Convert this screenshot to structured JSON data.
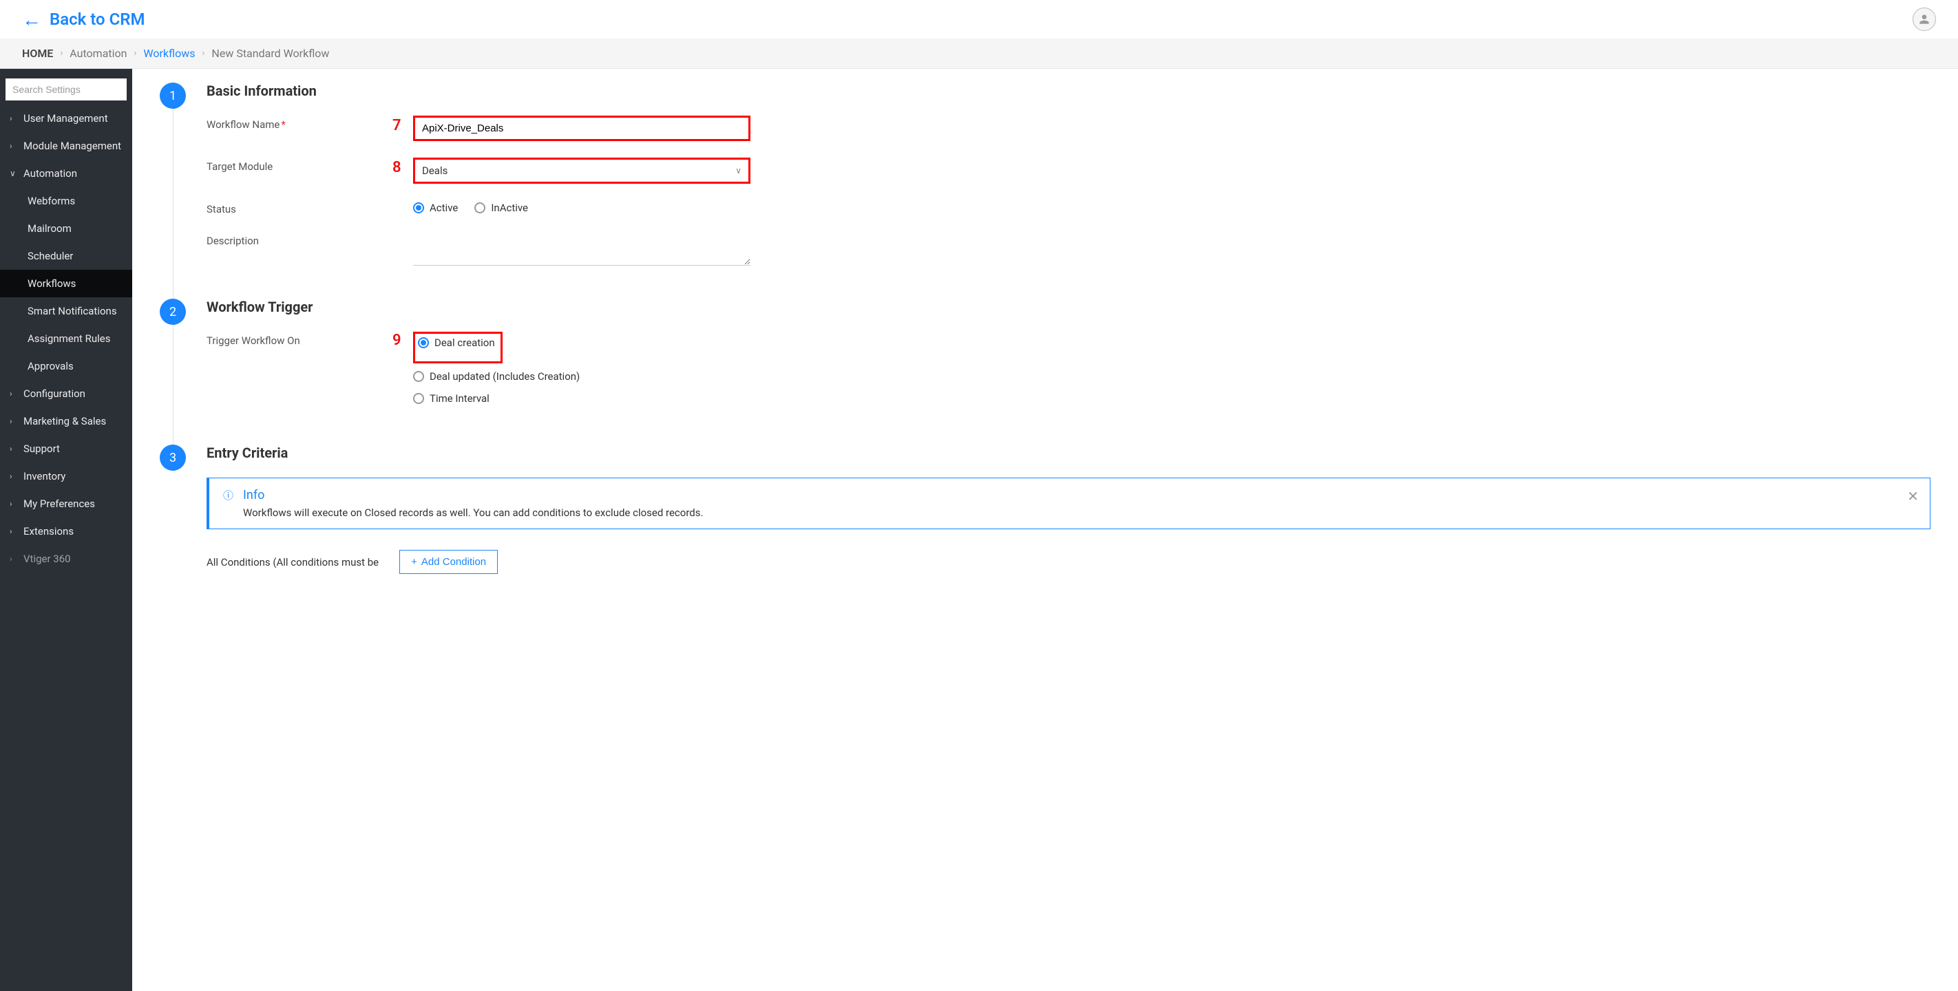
{
  "topbar": {
    "back_label": "Back to CRM"
  },
  "breadcrumb": {
    "home": "HOME",
    "automation": "Automation",
    "workflows": "Workflows",
    "current": "New Standard Workflow"
  },
  "sidebar": {
    "search_placeholder": "Search Settings",
    "items": [
      {
        "label": "User Management",
        "expanded": false
      },
      {
        "label": "Module Management",
        "expanded": false
      },
      {
        "label": "Automation",
        "expanded": true,
        "children": [
          {
            "label": "Webforms"
          },
          {
            "label": "Mailroom"
          },
          {
            "label": "Scheduler"
          },
          {
            "label": "Workflows",
            "active": true
          },
          {
            "label": "Smart Notifications"
          },
          {
            "label": "Assignment Rules"
          },
          {
            "label": "Approvals"
          }
        ]
      },
      {
        "label": "Configuration",
        "expanded": false
      },
      {
        "label": "Marketing & Sales",
        "expanded": false
      },
      {
        "label": "Support",
        "expanded": false
      },
      {
        "label": "Inventory",
        "expanded": false
      },
      {
        "label": "My Preferences",
        "expanded": false
      },
      {
        "label": "Extensions",
        "expanded": false
      },
      {
        "label": "Vtiger 360",
        "expanded": false
      }
    ]
  },
  "steps": {
    "s1": {
      "num": "1",
      "title": "Basic Information",
      "workflow_name_label": "Workflow Name",
      "workflow_name_value": "ApiX-Drive_Deals",
      "target_module_label": "Target Module",
      "target_module_value": "Deals",
      "status_label": "Status",
      "status_active": "Active",
      "status_inactive": "InActive",
      "description_label": "Description"
    },
    "s2": {
      "num": "2",
      "title": "Workflow Trigger",
      "trigger_label": "Trigger Workflow On",
      "opt_creation": "Deal creation",
      "opt_updated": "Deal updated  (Includes Creation)",
      "opt_time": "Time Interval"
    },
    "s3": {
      "num": "3",
      "title": "Entry Criteria",
      "info_title": "Info",
      "info_text": "Workflows will execute on Closed records as well. You can add conditions to exclude closed records.",
      "all_conditions": "All Conditions (All conditions must be",
      "add_condition": "Add Condition"
    }
  },
  "annotations": {
    "a7": "7",
    "a8": "8",
    "a9": "9"
  }
}
